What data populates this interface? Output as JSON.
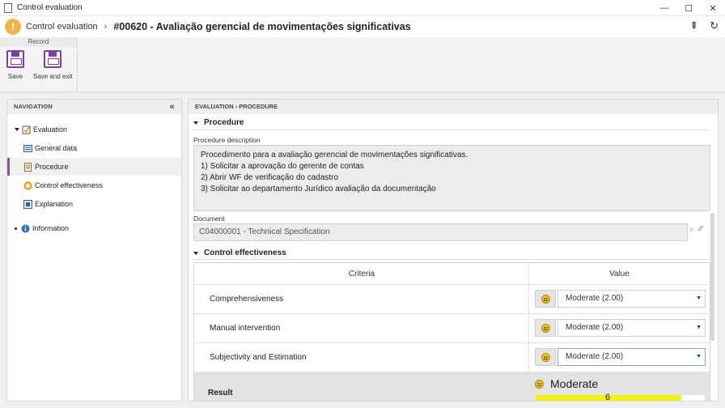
{
  "window": {
    "title": "Control evaluation",
    "controls": [
      "—",
      "☐",
      "✕"
    ]
  },
  "header": {
    "warning_glyph": "!",
    "breadcrumb_root": "Control evaluation",
    "separator": "›",
    "record_title": "#00620 - Avaliação gerencial de movimentações significativas",
    "tools": [
      "⇞",
      "↻"
    ]
  },
  "ribbon": {
    "group_label": "Record",
    "save_label": "Save",
    "save_exit_label": "Save and exit"
  },
  "navigation": {
    "title": "NAVIGATION",
    "collapse_glyph": "«",
    "items": [
      {
        "label": "Evaluation",
        "icon": "evaluation-icon"
      },
      {
        "label": "General data",
        "icon": "form-icon"
      },
      {
        "label": "Procedure",
        "icon": "document-icon"
      },
      {
        "label": "Control effectiveness",
        "icon": "effectiveness-icon"
      },
      {
        "label": "Explanation",
        "icon": "explanation-icon"
      },
      {
        "label": "Information",
        "icon": "info-icon"
      }
    ]
  },
  "main": {
    "breadcrumb": "EVALUATION  ›  PROCEDURE",
    "procedure": {
      "section_title": "Procedure",
      "description_label": "Procedure description",
      "description_lines": [
        "Procedimento para a avaliação gerencial de movimentações significativas.",
        "1) Solicitar a aprovação do gerente de contas",
        "2) Abrir WF de verificação do cadastro",
        "3) Solicitar ao departamento Jurídico avaliação da documentação"
      ],
      "document_label": "Document",
      "document_value": "C04000001 - Technical Specification"
    },
    "effectiveness": {
      "section_title": "Control effectiveness",
      "columns": [
        "Criteria",
        "Value"
      ],
      "rows": [
        {
          "criteria": "Comprehensiveness",
          "value": "Moderate (2.00)"
        },
        {
          "criteria": "Manual intervention",
          "value": "Moderate (2.00)"
        },
        {
          "criteria": "Subjectivity and Estimation",
          "value": "Moderate (2.00)"
        }
      ],
      "result_label": "Result",
      "result_value": "Moderate",
      "result_score": "6",
      "result_fill_percent": 86,
      "result_color": "#f5f10a"
    }
  }
}
